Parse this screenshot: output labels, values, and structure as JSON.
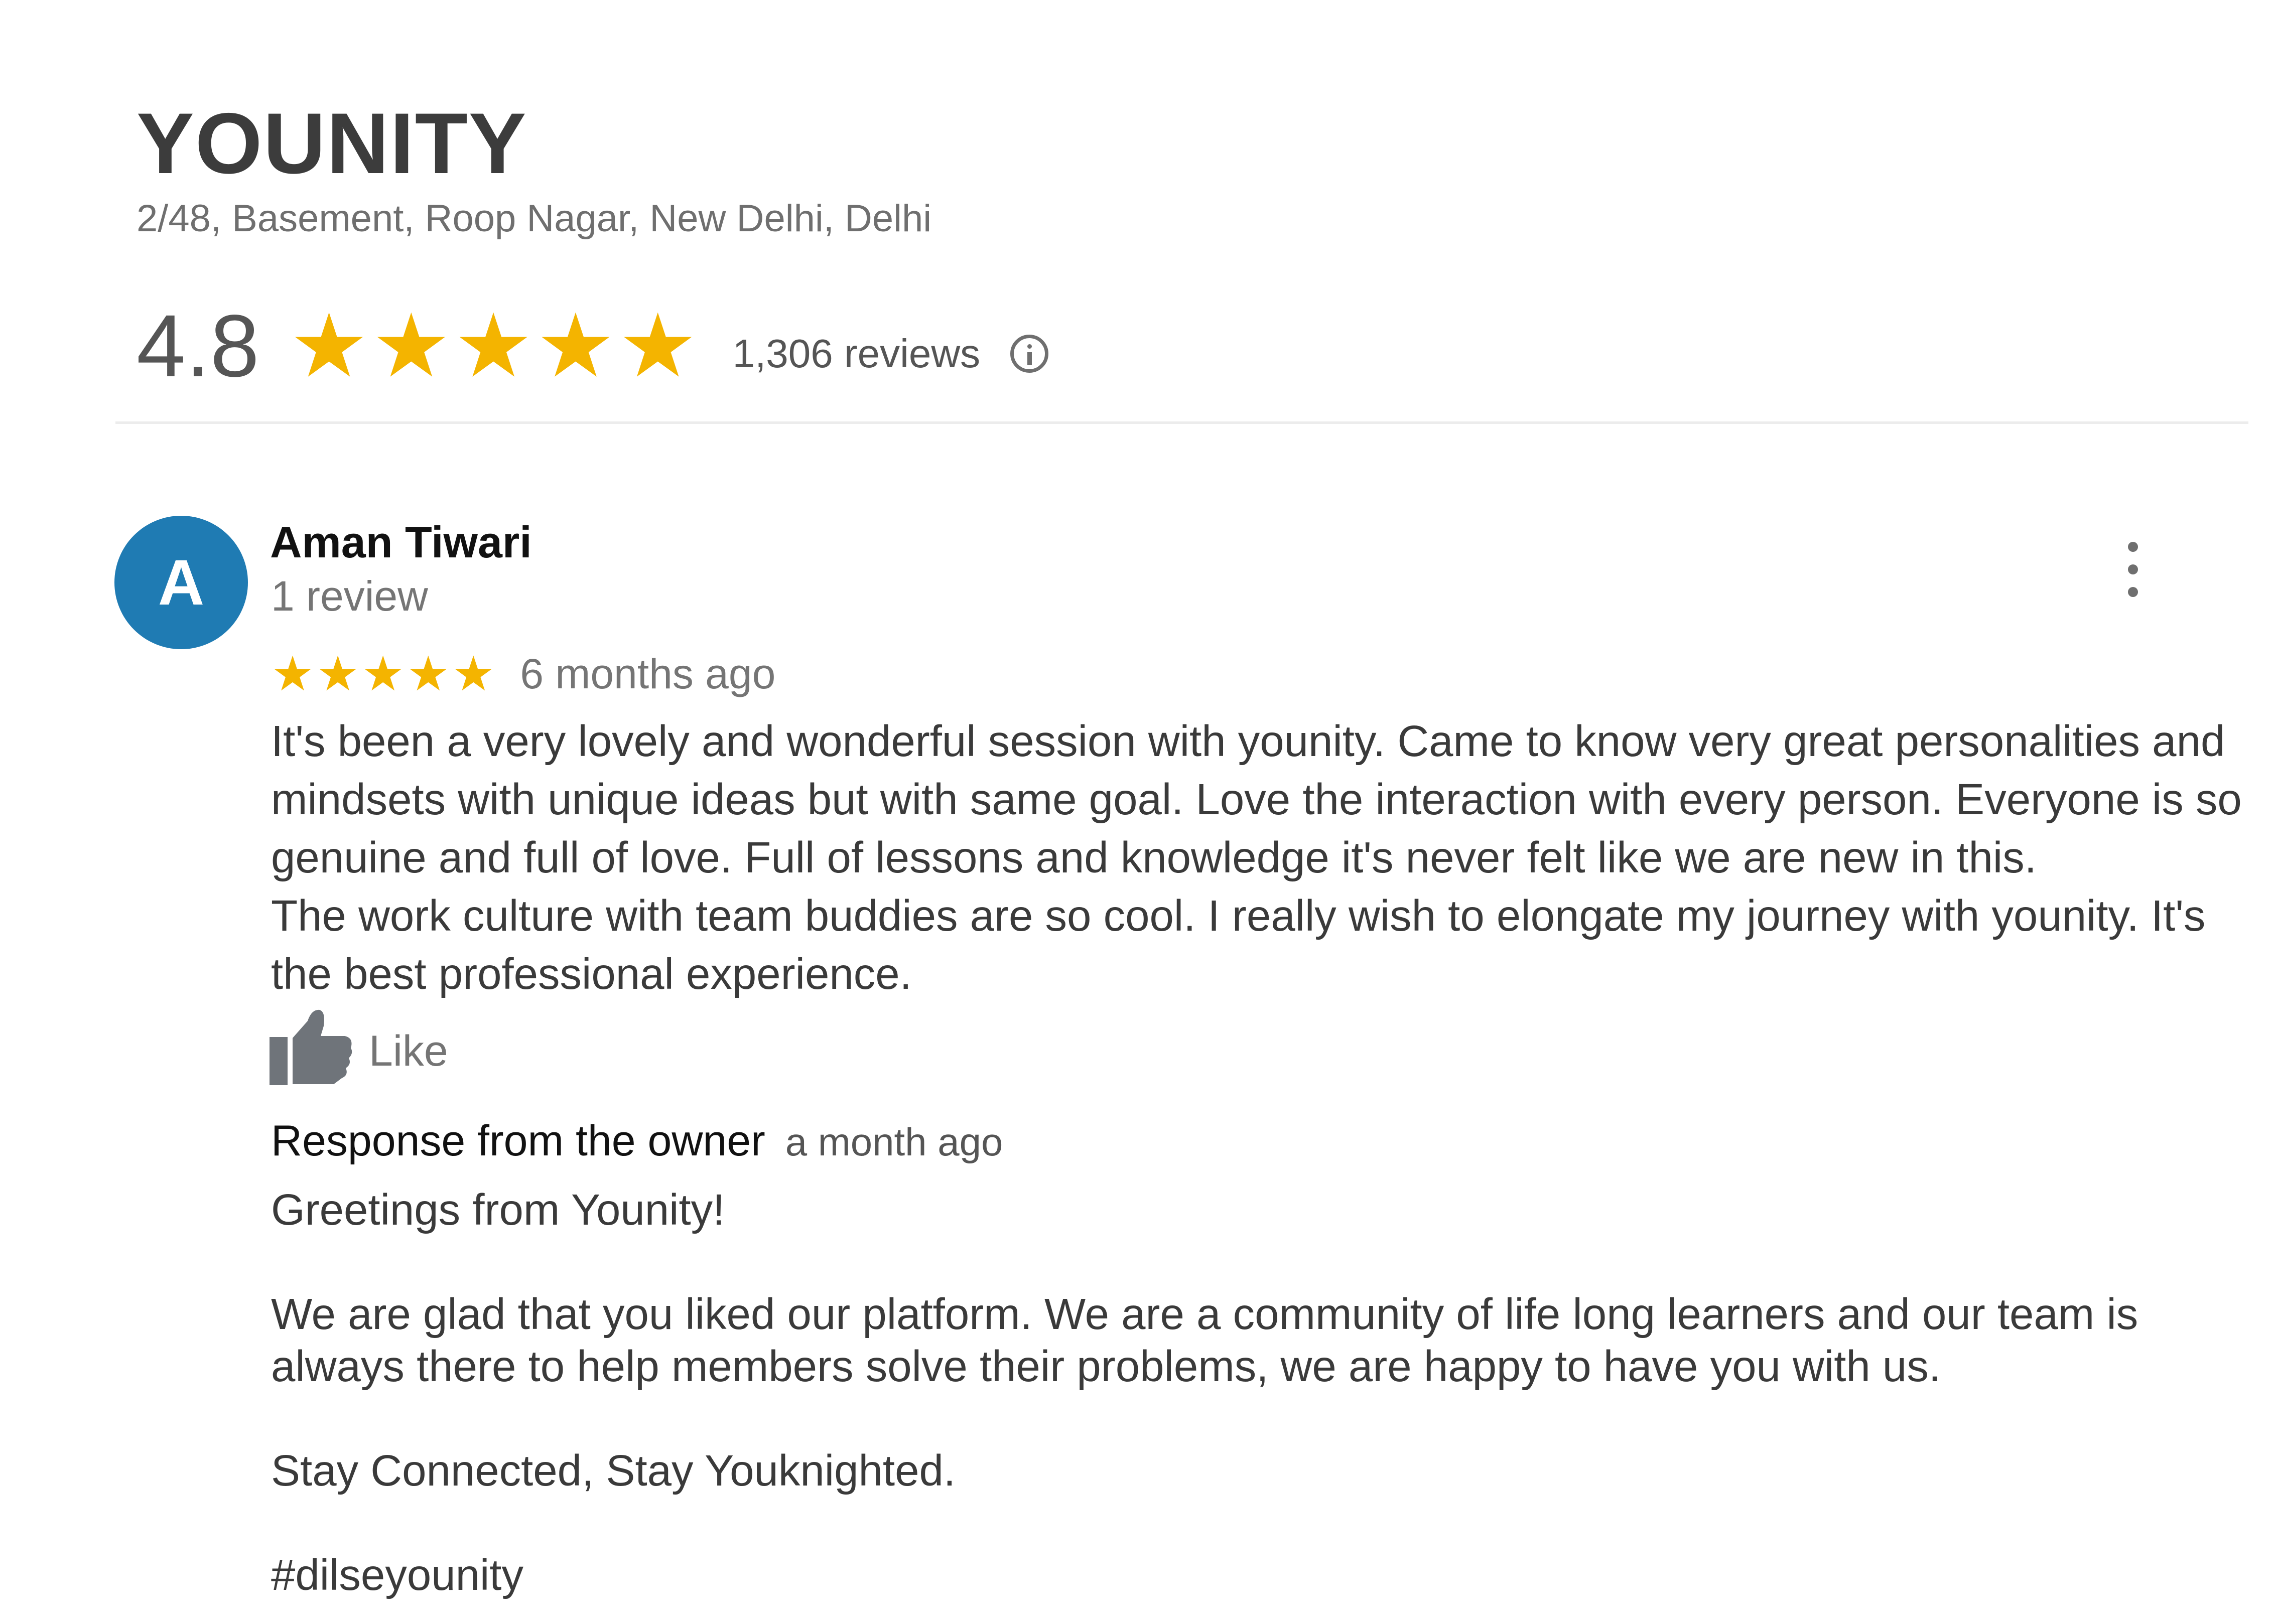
{
  "business": {
    "name": "YOUNITY",
    "address": "2/48, Basement, Roop Nagar, New Delhi, Delhi",
    "rating": "4.8",
    "star_count": 5,
    "reviews_count": "1,306 reviews",
    "info_icon": "info-icon"
  },
  "review": {
    "avatar_letter": "A",
    "avatar_color": "#1f7bb3",
    "author": "Aman Tiwari",
    "author_meta": "1 review",
    "stars": 5,
    "star_color": "#f4b400",
    "time": "6 months ago",
    "body": [
      "It's been a very lovely and wonderful session with younity. Came to know very great personalities and mindsets with unique ideas but with same goal. Love the interaction with every person. Everyone is so genuine and full of love. Full of lessons and knowledge it's never felt like we are new in this.",
      "The work culture with team buddies are so cool. I really wish to elongate my journey with younity. It's the best professional experience."
    ],
    "like_label": "Like",
    "more_icon": "more-vert-icon"
  },
  "owner_response": {
    "title": "Response from the owner",
    "time": "a month ago",
    "paragraphs": [
      "Greetings from Younity!",
      "We are glad that you liked our platform. We are a community of life long learners and our team is always there to help members solve their problems, we are happy to have you with us.",
      "Stay Connected, Stay Youknighted.",
      "#dilseyounity"
    ]
  }
}
